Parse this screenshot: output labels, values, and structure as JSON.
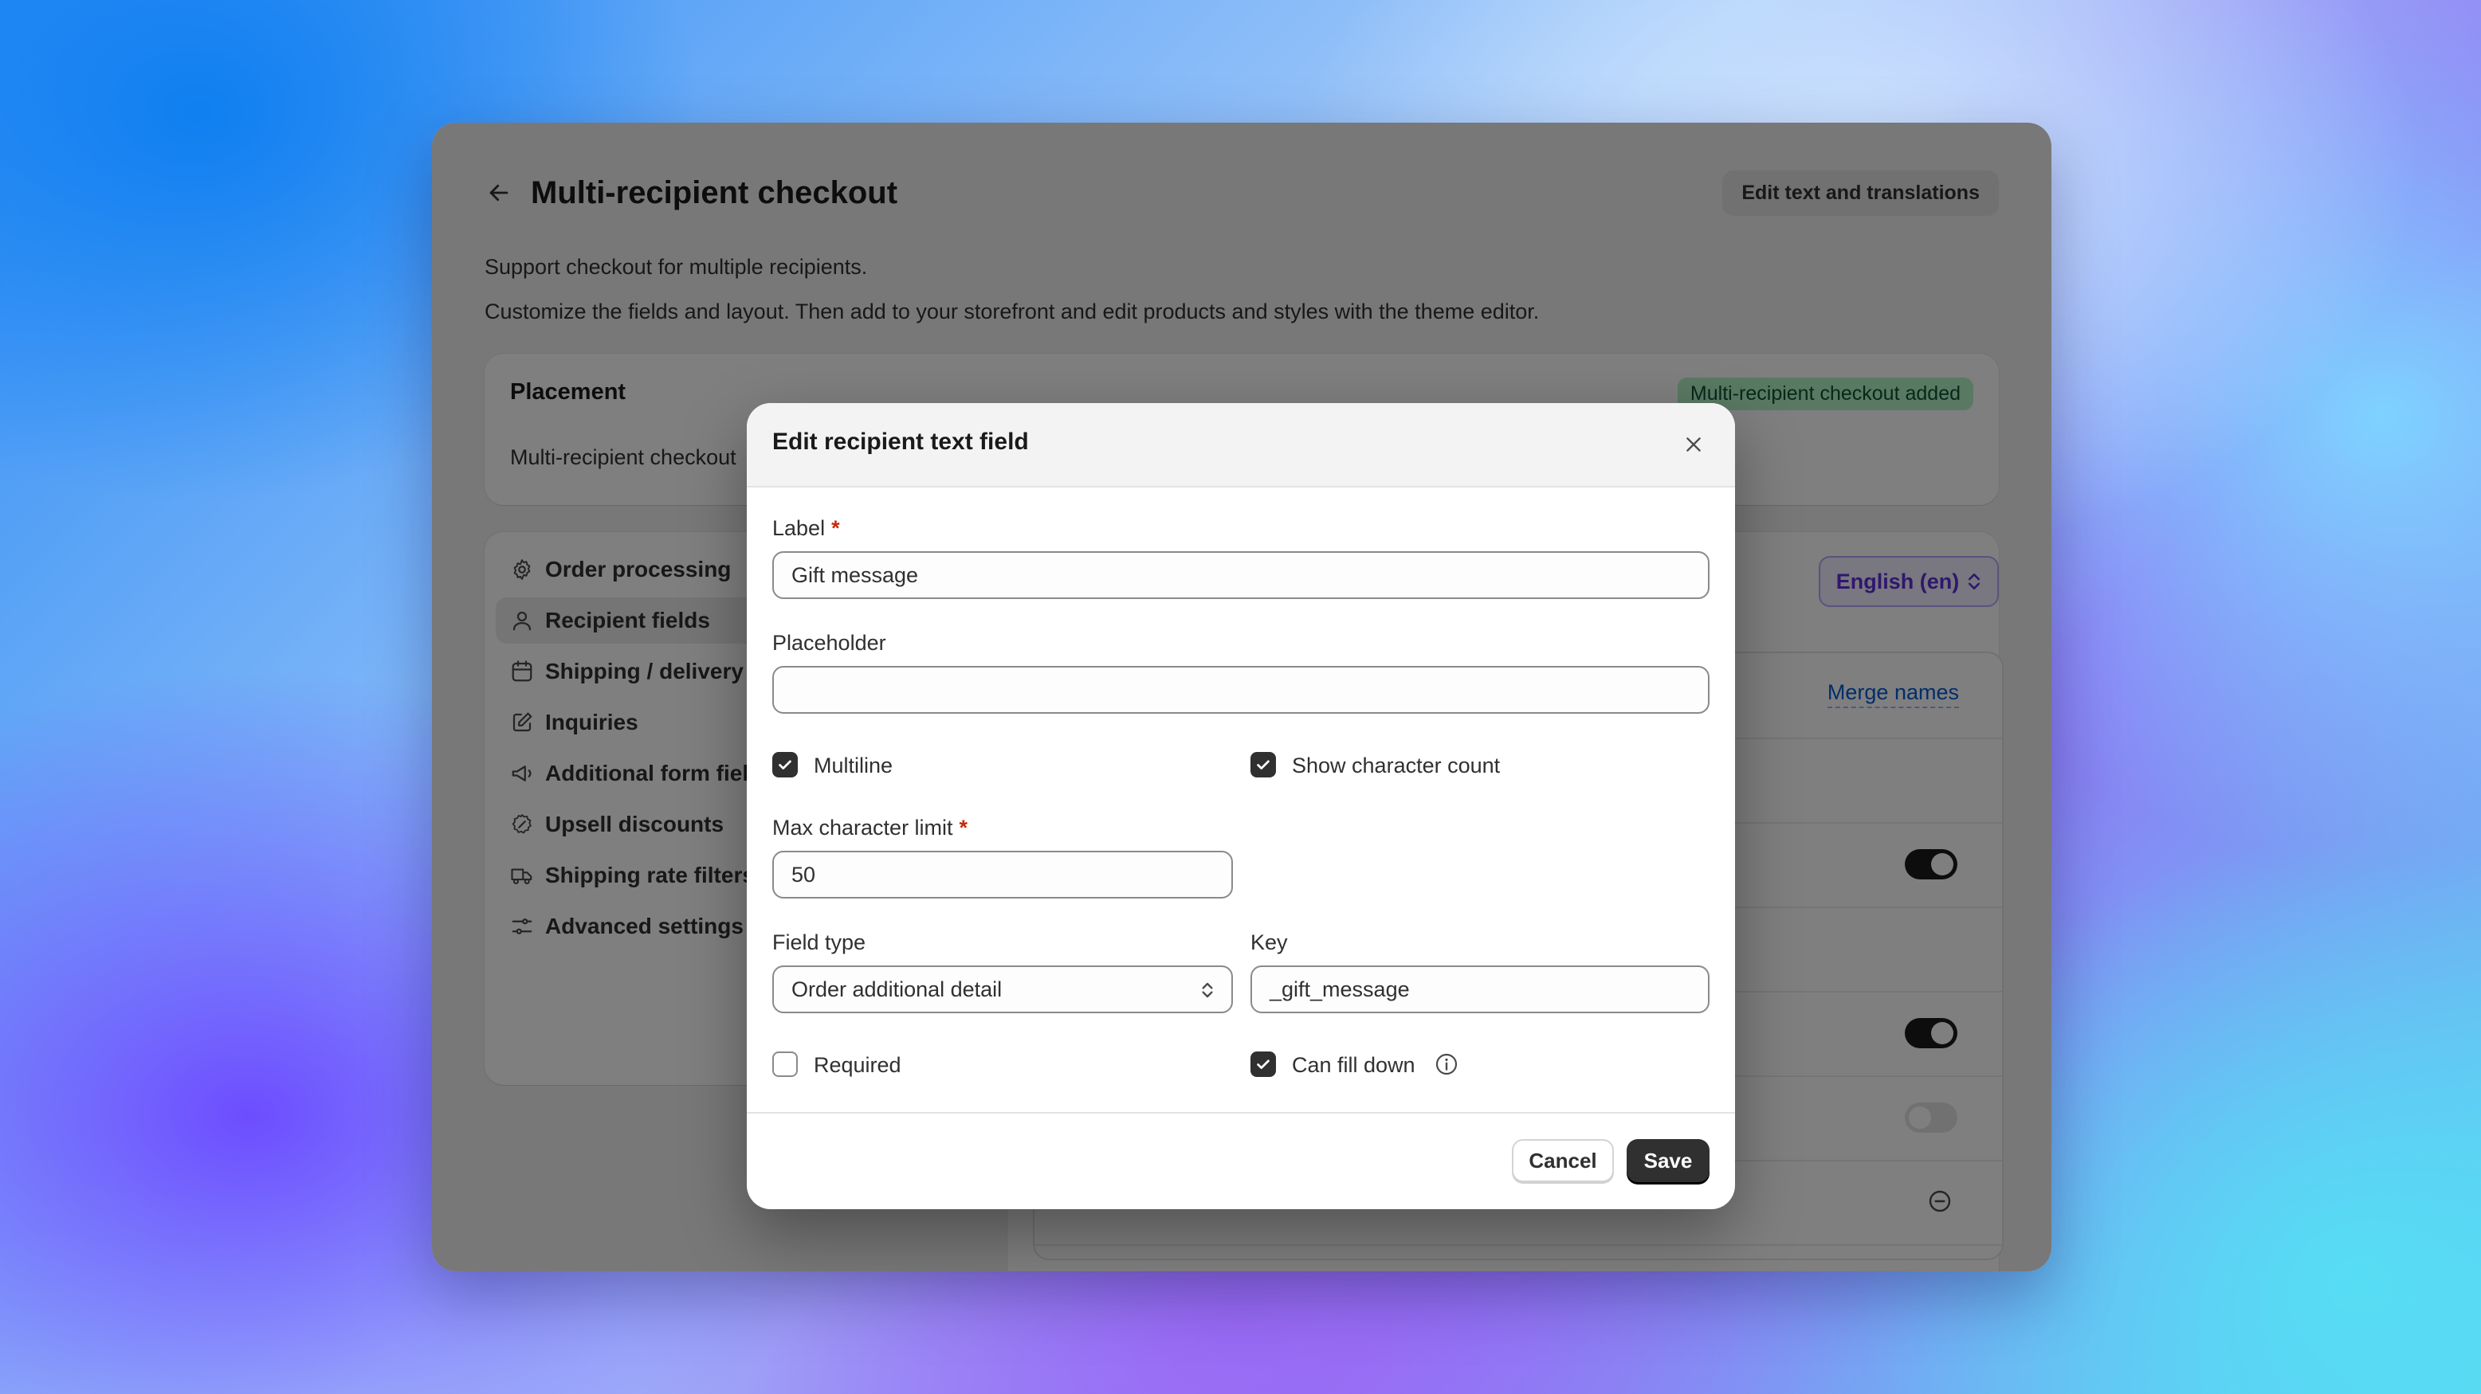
{
  "page": {
    "title": "Multi-recipient checkout",
    "edit_translations_label": "Edit text and translations",
    "description_1": "Support checkout for multiple recipients.",
    "description_2": "Customize the fields and layout. Then add to your storefront and edit products and styles with the theme editor."
  },
  "placement": {
    "title": "Placement",
    "badge": "Multi-recipient checkout added",
    "subtitle": "Multi-recipient checkout"
  },
  "sidebar": {
    "items": [
      {
        "label": "Order processing",
        "icon": "gear-icon"
      },
      {
        "label": "Recipient fields",
        "icon": "person-icon",
        "active": true
      },
      {
        "label": "Shipping / delivery",
        "icon": "calendar-icon"
      },
      {
        "label": "Inquiries",
        "icon": "edit-icon"
      },
      {
        "label": "Additional form fields",
        "icon": "megaphone-icon"
      },
      {
        "label": "Upsell discounts",
        "icon": "discount-icon"
      },
      {
        "label": "Shipping rate filters",
        "icon": "truck-icon"
      },
      {
        "label": "Advanced settings",
        "icon": "sliders-icon"
      }
    ]
  },
  "content": {
    "language_select": "English (en)",
    "merge_names_label": "Merge names"
  },
  "modal": {
    "title": "Edit recipient text field",
    "label_field": {
      "label": "Label",
      "value": "Gift message"
    },
    "placeholder_field": {
      "label": "Placeholder",
      "value": ""
    },
    "multiline": {
      "label": "Multiline",
      "checked": true
    },
    "show_char_count": {
      "label": "Show character count",
      "checked": true
    },
    "max_char_limit": {
      "label": "Max character limit",
      "value": "50"
    },
    "field_type": {
      "label": "Field type",
      "value": "Order additional detail"
    },
    "key": {
      "label": "Key",
      "value": "_gift_message"
    },
    "required": {
      "label": "Required",
      "checked": false
    },
    "can_fill_down": {
      "label": "Can fill down",
      "checked": true
    },
    "required_marker": "*",
    "cancel_label": "Cancel",
    "save_label": "Save"
  }
}
